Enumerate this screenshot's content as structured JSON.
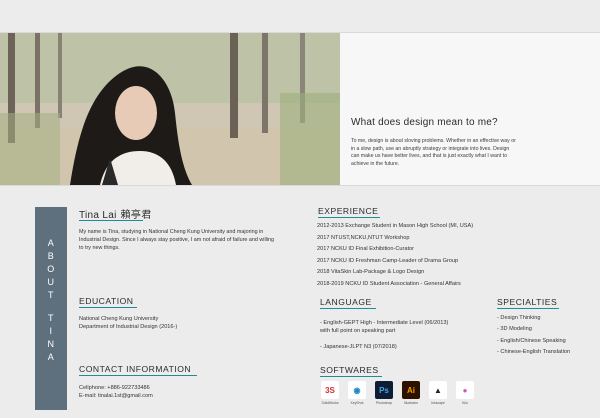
{
  "question": {
    "title": "What does design mean to me?",
    "body": "To me, design is about sloving problems. Whether in an effective way or in a slow path, use an abruptly strategy or integrate into lives. Design can make us have better lives, and that is just exactly what I want to achieve in the future."
  },
  "sidebar": {
    "word1": [
      "A",
      "B",
      "O",
      "U",
      "T"
    ],
    "word2": [
      "T",
      "I",
      "N",
      "A"
    ]
  },
  "profile": {
    "name": "Tina Lai",
    "name_cn": "賴亭君",
    "bio": "My name is Tina, studying in National Cheng Kung University and majoring in Industrial Design. Since I always stay positive, I am not afraid of failure and willing to try new things."
  },
  "education": {
    "title": "EDUCATION",
    "line1": "National Cheng Kung University",
    "line2": "Department of Industrial Design (2016-)"
  },
  "contact": {
    "title": "CONTACT INFORMATION",
    "phone": "Cellphone: +886-922733486",
    "email": "E-mail: tinalai.1st@gmail.com"
  },
  "experience": {
    "title": "EXPERIENCE",
    "items": [
      "2012-2013 Exchange Student in Mason High School (MI, USA)",
      "2017 NTUST,NCKU,NTUT Workshop",
      "2017 NCKU ID Final Exhibition-Curator",
      "2017 NCKU ID Freshman Camp-Leader of Drama Group",
      "2018 VitaSkin Lab-Package & Logo Design",
      "2018-2019 NCKU ID Student Association - General Affairs"
    ]
  },
  "language": {
    "title": "LANGUAGE",
    "item1a": "- English-GEPT High - Intermediate Level (06/2013)",
    "item1b": "with full point on speaking part",
    "item2": "- Japanese-JLPT N3 (07/2018)"
  },
  "specialties": {
    "title": "SPECIALTIES",
    "items": [
      "- Design Thinking",
      "- 3D Modeling",
      "- English/Chinese Speaking",
      "- Chinese-English Translation"
    ]
  },
  "softwares": {
    "title": "SOFTWARES",
    "items": [
      {
        "icon": "solidworks-icon",
        "glyph": "3S",
        "label": "SolidWorks",
        "bg": "#ffffff",
        "fg": "#d32f2f"
      },
      {
        "icon": "keyshot-icon",
        "glyph": "◉",
        "label": "KeyShot",
        "bg": "#ffffff",
        "fg": "#1e88c8"
      },
      {
        "icon": "photoshop-icon",
        "glyph": "Ps",
        "label": "Photoshop",
        "bg": "#0e1d33",
        "fg": "#41a5ee"
      },
      {
        "icon": "illustrator-icon",
        "glyph": "Ai",
        "label": "Illustrator",
        "bg": "#2b1200",
        "fg": "#ff9a00"
      },
      {
        "icon": "inkscape-icon",
        "glyph": "▲",
        "label": "Inkscape",
        "bg": "#ffffff",
        "fg": "#222222"
      },
      {
        "icon": "kilo-icon",
        "glyph": "●",
        "label": "Kilo",
        "bg": "#ffffff",
        "fg": "#d454c8"
      }
    ]
  },
  "colors": {
    "accent": "#1f8d94",
    "sidebar": "#5e6f7e",
    "background": "#ececec"
  }
}
